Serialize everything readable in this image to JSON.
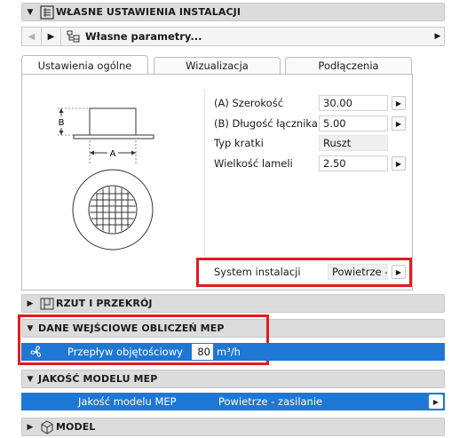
{
  "header": {
    "title": "WŁASNE USTAWIENIA INSTALACJI"
  },
  "nav": {
    "title": "Własne parametry..."
  },
  "tabs": [
    "Ustawienia ogólne",
    "Wizualizacja",
    "Podłączenia"
  ],
  "diagram": {
    "label_b": "B",
    "label_a": "A"
  },
  "params": [
    {
      "label": "(A) Szerokość",
      "value": "30.00"
    },
    {
      "label": "(B) Długość łącznika",
      "value": "5.00"
    },
    {
      "label": "Typ kratki",
      "value": "Ruszt"
    },
    {
      "label": "Wielkość lameli",
      "value": "2.50"
    }
  ],
  "system": {
    "label": "System instalacji",
    "value": "Powietrze - :"
  },
  "sections": {
    "rzut": "RZUT I PRZEKRÓJ",
    "dane": "DANE WEJŚCIOWE OBLICZEŃ MEP",
    "jakosc": "JAKOŚĆ MODELU MEP",
    "model": "MODEL"
  },
  "flow": {
    "label": "Przepływ objętościowy",
    "value": "80",
    "unit": "m³/h"
  },
  "quality": {
    "label": "Jakość modelu MEP",
    "value": "Powietrze - zasilanie"
  },
  "colors": {
    "selection": "#1f77d4",
    "highlight": "#e11d1d",
    "section_bg": "#dcdcdc"
  }
}
